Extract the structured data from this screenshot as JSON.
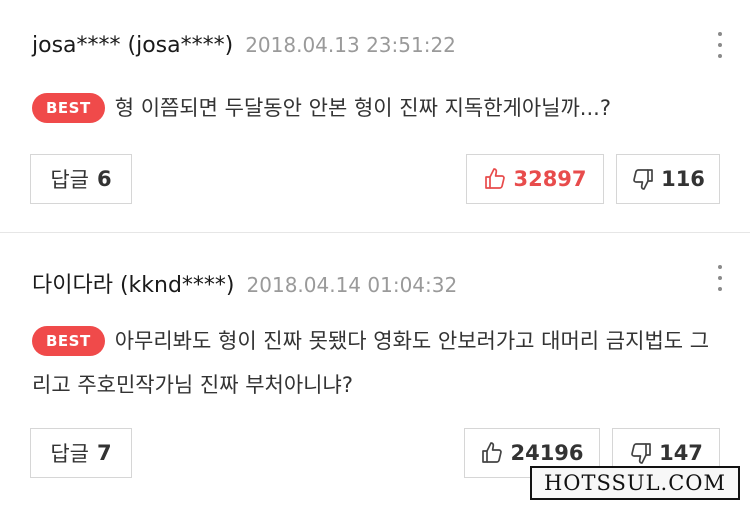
{
  "comments": [
    {
      "author": "josa**** (josa****)",
      "date": "2018.04.13 23:51:22",
      "badge": "BEST",
      "text": "형 이쯤되면 두달동안 안본 형이 진짜 지독한게아닐까...?",
      "reply_label": "답글",
      "reply_count": "6",
      "likes": "32897",
      "dislikes": "116",
      "liked": true
    },
    {
      "author": "다이다라 (kknd****)",
      "date": "2018.04.14 01:04:32",
      "badge": "BEST",
      "text": "아무리봐도 형이 진짜 못됐다 영화도 안보러가고 대머리 금지법도 그리고 주호민작가님 진짜 부처아니냐?",
      "reply_label": "답글",
      "reply_count": "7",
      "likes": "24196",
      "dislikes": "147",
      "liked": false
    }
  ],
  "watermark": "HOTSSUL.COM",
  "colors": {
    "accent": "#f04a4a",
    "liked": "#e84c4c",
    "muted": "#9a9a9a"
  },
  "icons": {
    "more": "more-vertical-icon",
    "like": "thumbs-up-icon",
    "dislike": "thumbs-down-icon"
  }
}
